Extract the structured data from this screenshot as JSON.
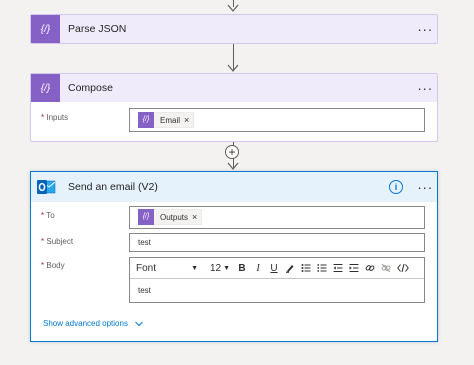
{
  "flow": {
    "parse_json": {
      "title": "Parse JSON",
      "more": "···",
      "icon": "curly-braces-icon"
    },
    "compose": {
      "title": "Compose",
      "more": "···",
      "icon": "curly-braces-icon",
      "inputs_label": "Inputs",
      "required_mark": "*",
      "token_label": "Email",
      "token_remove": "×"
    },
    "send_email": {
      "title": "Send an email (V2)",
      "more": "···",
      "icon": "outlook-icon",
      "info_glyph": "i",
      "to_label": "To",
      "to_token": "Outputs",
      "token_remove": "×",
      "subject_label": "Subject",
      "subject_value": "test",
      "body_label": "Body",
      "body_value": "test",
      "required_mark": "*",
      "toolbar": {
        "font": "Font",
        "size": "12",
        "bold": "B",
        "italic": "I",
        "underline": "U"
      },
      "show_advanced": "Show advanced options"
    }
  },
  "colors": {
    "purple_header": "#f0ebfb",
    "action_icon": "#8661c5",
    "outlook_header": "#e5f1fb",
    "outlook_icon": "#0364b8",
    "selected_border": "#0078d4",
    "link": "#0078d4"
  }
}
